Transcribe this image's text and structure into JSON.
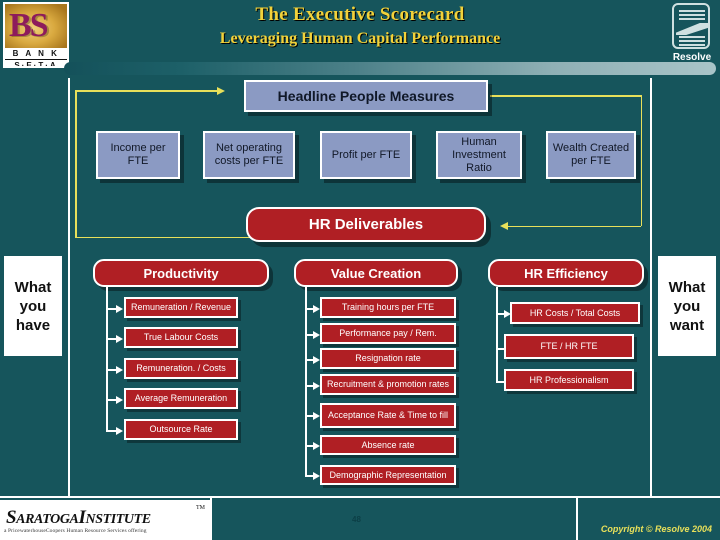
{
  "header": {
    "title": "The Executive Scorecard",
    "subtitle": "Leveraging Human Capital Performance",
    "logo_left": {
      "mono": "BS",
      "line1": "B A N K",
      "line2": "S·E·T·A"
    },
    "logo_right_caption": "Resolve"
  },
  "headline": {
    "label": "Headline People Measures"
  },
  "measures": [
    {
      "label": "Income per FTE"
    },
    {
      "label": "Net operating costs per FTE"
    },
    {
      "label": "Profit per FTE"
    },
    {
      "label": "Human Investment Ratio"
    },
    {
      "label": "Wealth Created per FTE"
    }
  ],
  "deliverables": {
    "label": "HR Deliverables"
  },
  "columns": [
    {
      "heading": "Productivity",
      "items": [
        "Remuneration / Revenue",
        "True Labour Costs",
        "Remuneration. / Costs",
        "Average Remuneration",
        "Outsource Rate"
      ]
    },
    {
      "heading": "Value Creation",
      "items": [
        "Training hours per FTE",
        "Performance pay / Rem.",
        "Resignation rate",
        "Recruitment & promotion rates",
        "Acceptance Rate & Time to fill",
        "Absence rate",
        "Demographic Representation"
      ]
    },
    {
      "heading": "HR Efficiency",
      "items": [
        "HR Costs / Total Costs",
        "FTE / HR FTE",
        "HR Professionalism"
      ]
    }
  ],
  "side_left": {
    "label": "What you have"
  },
  "side_right": {
    "label": "What you want"
  },
  "footer": {
    "brand_part1": "S",
    "brand_part2": "ARATOGA",
    "brand_part3": "I",
    "brand_part4": "NSTITUTE",
    "brand_tm": "TM",
    "tagline": "a PricewaterhouseCoopers Human Resource Services offering",
    "page_number": "48",
    "copyright": "Copyright © Resolve 2004"
  },
  "colors": {
    "background": "#16555c",
    "blue_box": "#8b9ac3",
    "red_box": "#b01f24",
    "accent_yellow": "#e8e05a",
    "white": "#ffffff"
  }
}
